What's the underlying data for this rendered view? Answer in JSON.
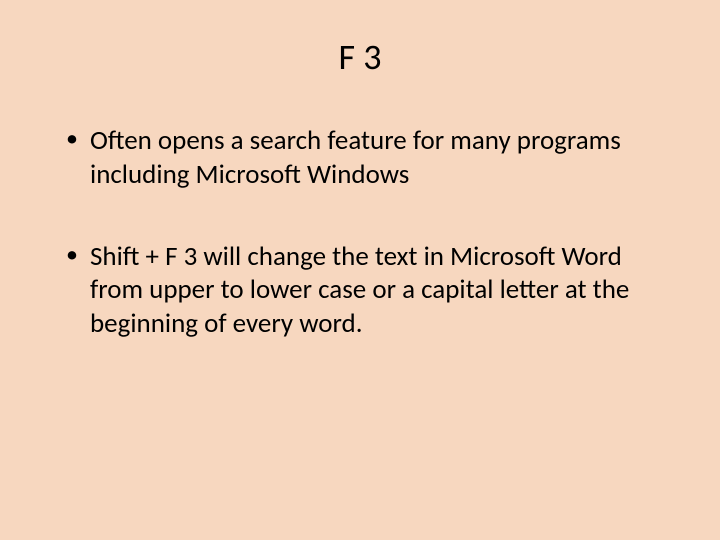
{
  "title": "F 3",
  "bullets": [
    "Often opens a search feature for many programs including Microsoft Windows",
    "Shift + F 3 will change the text in Microsoft Word from upper to lower case or a capital letter at the beginning of every word."
  ]
}
